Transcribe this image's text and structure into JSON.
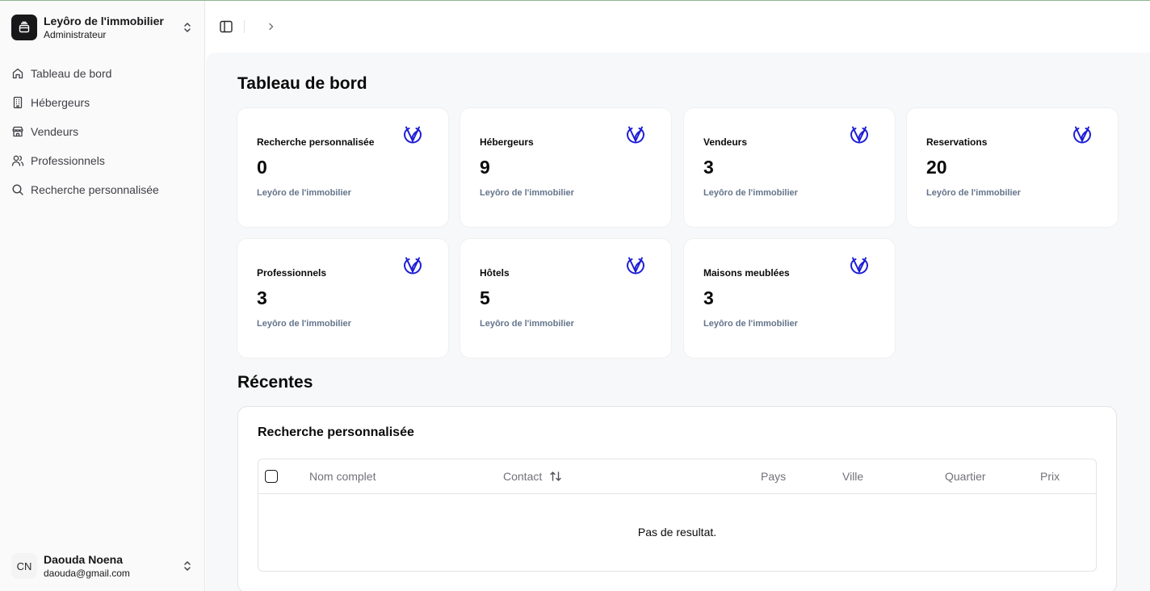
{
  "sidebar": {
    "org": {
      "name": "Leyôro de l'immobilier",
      "role": "Administrateur"
    },
    "items": [
      {
        "label": "Tableau de bord",
        "icon": "home-icon"
      },
      {
        "label": "Hébergeurs",
        "icon": "building-icon"
      },
      {
        "label": "Vendeurs",
        "icon": "store-icon"
      },
      {
        "label": "Professionnels",
        "icon": "users-icon"
      },
      {
        "label": "Recherche personnalisée",
        "icon": "search-icon"
      }
    ],
    "user": {
      "initials": "CN",
      "name": "Daouda Noena",
      "email": "daouda@gmail.com"
    }
  },
  "page": {
    "title": "Tableau de bord"
  },
  "cards": [
    {
      "label": "Recherche personnalisée",
      "value": "0",
      "sub": "Leyôro de l'immobilier"
    },
    {
      "label": "Hébergeurs",
      "value": "9",
      "sub": "Leyôro de l'immobilier"
    },
    {
      "label": "Vendeurs",
      "value": "3",
      "sub": "Leyôro de l'immobilier"
    },
    {
      "label": "Reservations",
      "value": "20",
      "sub": "Leyôro de l'immobilier"
    },
    {
      "label": "Professionnels",
      "value": "3",
      "sub": "Leyôro de l'immobilier"
    },
    {
      "label": "Hôtels",
      "value": "5",
      "sub": "Leyôro de l'immobilier"
    },
    {
      "label": "Maisons meublées",
      "value": "3",
      "sub": "Leyôro de l'immobilier"
    }
  ],
  "recent": {
    "title": "Récentes",
    "panel_title": "Recherche personnalisée",
    "columns": [
      "Nom complet",
      "Contact",
      "Pays",
      "Ville",
      "Quartier",
      "Prix"
    ],
    "empty_text": "Pas de resultat."
  },
  "colors": {
    "accent_icon": "#1d1dd6",
    "muted_text": "#64748b",
    "main_bg": "#f7f8fa"
  }
}
